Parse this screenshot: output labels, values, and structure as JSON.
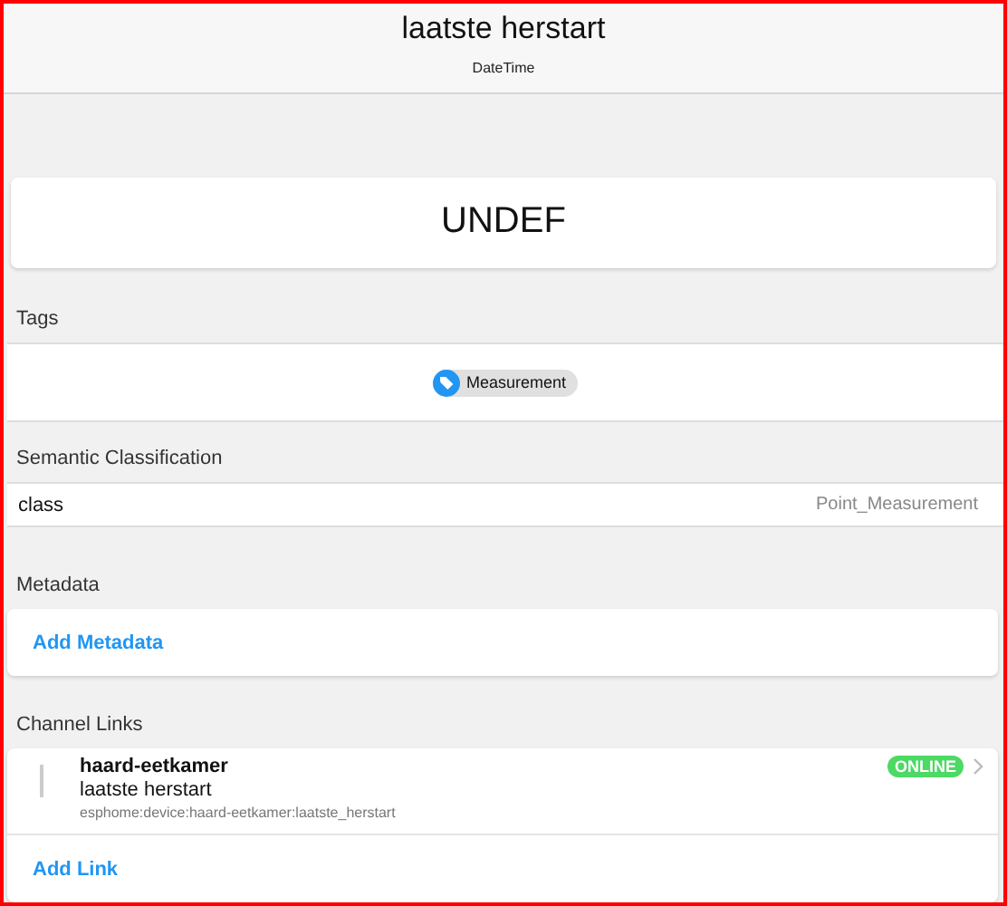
{
  "header": {
    "title": "laatste herstart",
    "subtitle": "DateTime"
  },
  "state": "UNDEF",
  "tags": {
    "heading": "Tags",
    "items": [
      "Measurement"
    ]
  },
  "semantic": {
    "heading": "Semantic Classification",
    "rows": [
      {
        "label": "class",
        "value": "Point_Measurement"
      }
    ]
  },
  "metadata": {
    "heading": "Metadata",
    "action": "Add Metadata"
  },
  "channel_links": {
    "heading": "Channel Links",
    "links": [
      {
        "thing": "haard-eetkamer",
        "channel": "laatste herstart",
        "uid": "esphome:device:haard-eetkamer:laatste_herstart",
        "status": "ONLINE"
      }
    ],
    "action": "Add Link"
  }
}
